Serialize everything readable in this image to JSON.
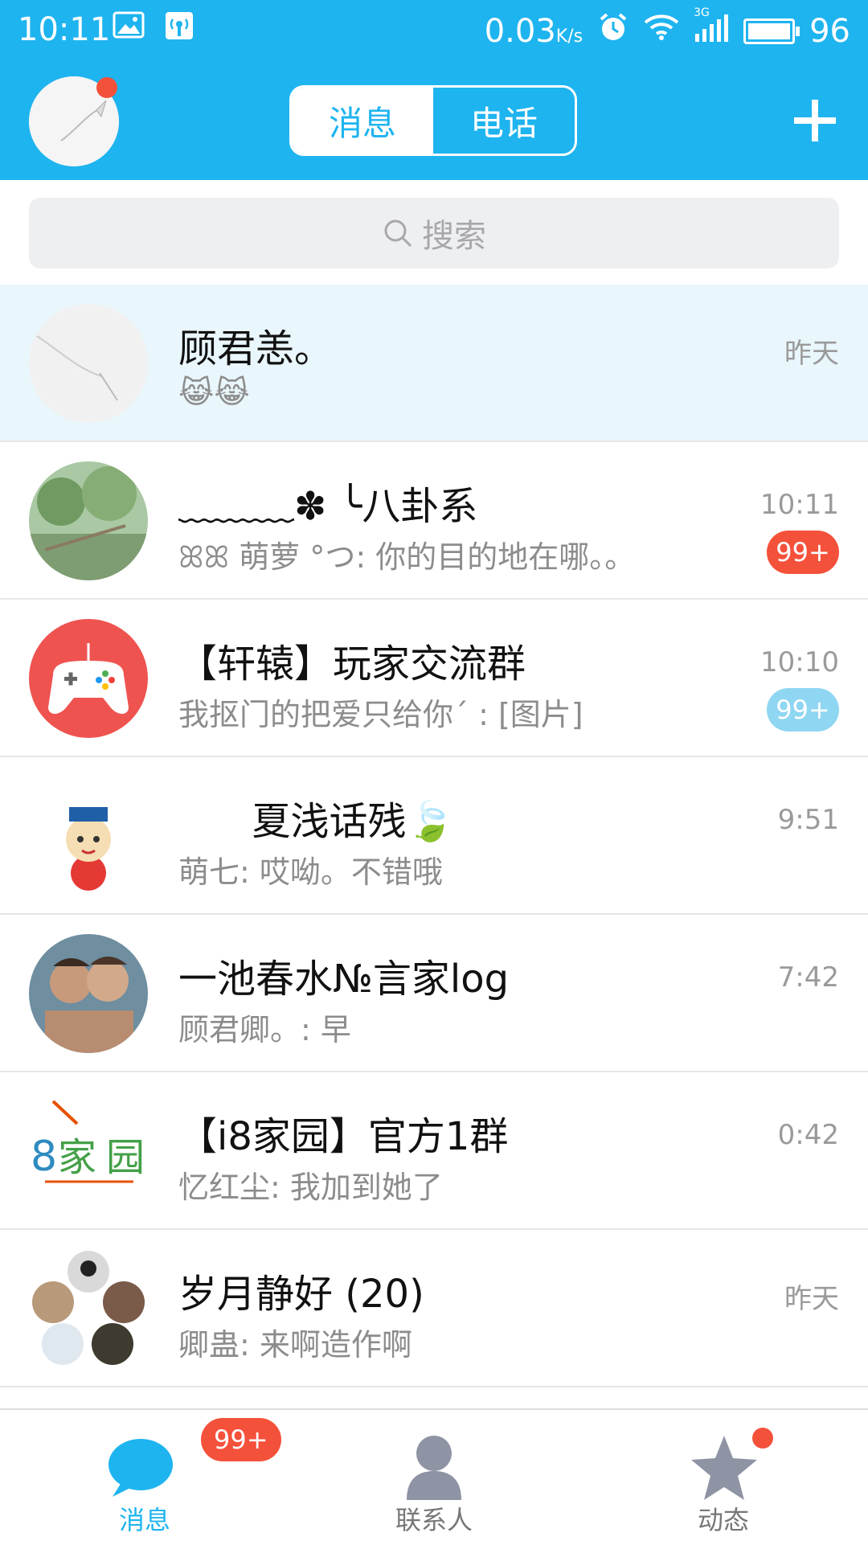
{
  "status_bar": {
    "time": "10:11",
    "speed": "0.03",
    "speed_unit": "K/s",
    "network": "3G",
    "battery": "96"
  },
  "header": {
    "tabs": [
      {
        "label": "消息",
        "active": true
      },
      {
        "label": "电话",
        "active": false
      }
    ],
    "accent_color": "#1eb4ef"
  },
  "search": {
    "placeholder": "搜索"
  },
  "conversations": [
    {
      "title": "顾君恙。",
      "subtitle": "😹😹",
      "time": "昨天",
      "badge": "",
      "highlight": true
    },
    {
      "title": "﹏﹏﹏✽          ╰八卦系",
      "subtitle": "ꕤꕤ   萌萝 °つ: 你的目的地在哪。。",
      "time": "10:11",
      "badge": "99+",
      "badge_style": "red"
    },
    {
      "title": "【轩辕】玩家交流群",
      "subtitle": "我抠门的把爱只给你ˊ  : [图片]",
      "time": "10:10",
      "badge": "99+",
      "badge_style": "light"
    },
    {
      "title": "      夏浅话残🍃",
      "subtitle": "萌七: 哎呦。不错哦",
      "time": "9:51",
      "badge": ""
    },
    {
      "title": "一池春水№言家log",
      "subtitle": "顾君卿。: 早",
      "time": "7:42",
      "badge": ""
    },
    {
      "title": "【i8家园】官方1群",
      "subtitle": "忆红尘: 我加到她了",
      "time": "0:42",
      "badge": ""
    },
    {
      "title": "岁月静好 (20)",
      "subtitle": "卿蛊: 来啊造作啊",
      "time": "昨天",
      "badge": ""
    }
  ],
  "bottom_nav": {
    "messages": {
      "label": "消息",
      "badge": "99+"
    },
    "contacts": {
      "label": "联系人"
    },
    "feed": {
      "label": "动态"
    }
  }
}
